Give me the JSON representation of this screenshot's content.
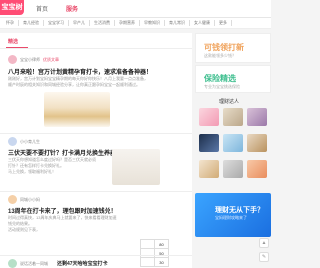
{
  "app": {
    "logo": "宝宝树"
  },
  "topnav": [
    {
      "label": "首页",
      "active": false
    },
    {
      "label": "服务",
      "active": true
    }
  ],
  "catbar": [
    {
      "label": "怀孕",
      "active": false
    },
    {
      "label": "育儿经验",
      "active": false
    },
    {
      "label": "宝宝学习",
      "active": false
    },
    {
      "label": "早产儿",
      "active": false
    },
    {
      "label": "生活消费",
      "active": false
    },
    {
      "label": "孕期营养",
      "active": false
    },
    {
      "label": "早教知识",
      "active": false
    },
    {
      "label": "育儿常识",
      "active": false
    },
    {
      "label": "女人健康",
      "active": false
    },
    {
      "label": "更多",
      "active": false
    }
  ],
  "main": {
    "tab": "精选",
    "posts": [
      {
        "author": "宝宝小律师",
        "meta": "优质文章",
        "title": "八月来啦！宫万计划黄精孕育打卡，速求准备备神器！",
        "text1": "刚刚好，宫万计划宝妈宝宝精孕期的每天你好你快乐！八月上我要一点点准备，",
        "text2": "顺产时辰的相关知识和同城经验分享，让你真正跟孕妈宝宝一起顺利通过。"
      },
      {
        "author": "小小育儿生",
        "meta": "",
        "title": "三伏天要不要打针？打卡满月兑换生养器！",
        "text1": "三伏天你想知道怎么度过好吗？是否三伏天就必须打针？还有怎样打卡兑换好礼。",
        "text2": "马上兑换，领取福利好礼！"
      },
      {
        "author": "同城小小妈",
        "meta": "",
        "title": "13周年在打卡来了，理包跟时加速钱兑！",
        "text1": "时间过得真快，13周年庆典马上就要来了，快来看看理财加速钱兑的结果。",
        "text2": "活动规则见下表，",
        "table": [
          [
            "",
            "80"
          ],
          [
            "",
            "50"
          ],
          [
            "",
            "30"
          ]
        ]
      },
      {
        "author": "说话活着一同城",
        "meta": "",
        "title": "还剩47天哈哈宝宝打卡"
      }
    ]
  },
  "rail": {
    "ad1": {
      "title": "可钱领打新",
      "sub": "这款能领多少钱？"
    },
    "ad2": {
      "title": "保险精选",
      "sub": "专业为宝宝挑选保险"
    },
    "section_title": "理财达人",
    "promo": {
      "title": "理财无从下手？",
      "sub": "宝妈理财攻略来了"
    }
  },
  "colors": {
    "accent": "#e94a6a",
    "ad_orange": "#f0a35c",
    "ad_green": "#3fbf8f",
    "promo_blue": "#1b6fe0"
  }
}
